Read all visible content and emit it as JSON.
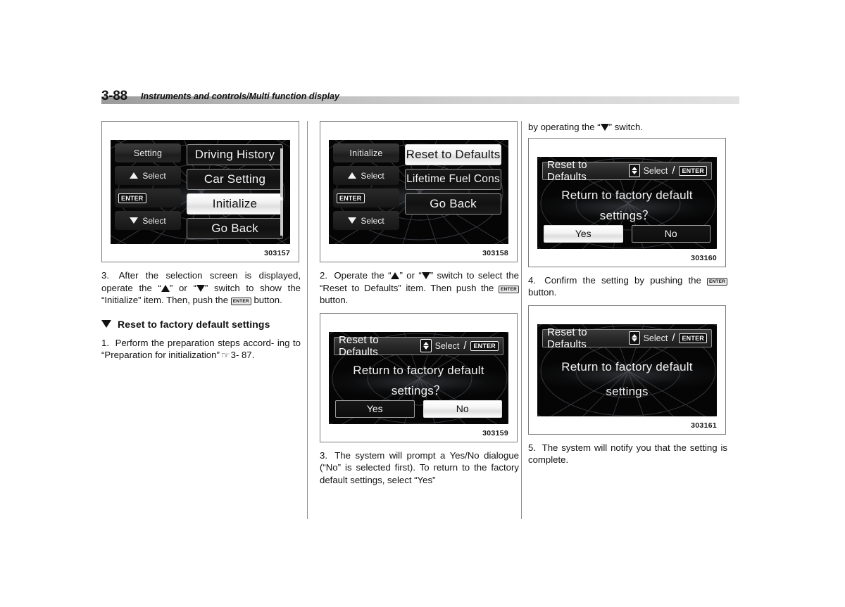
{
  "header": {
    "page_number": "3-88",
    "title": "Instruments and controls/Multi function display"
  },
  "column1": {
    "figure": {
      "figure_number": "303157",
      "screen": {
        "rail_title": "Setting",
        "rail_up_label": "Select",
        "rail_enter_label": "ENTER",
        "rail_down_label": "Select",
        "menu_items": [
          {
            "label": "Driving History",
            "selected": false
          },
          {
            "label": "Car Setting",
            "selected": false
          },
          {
            "label": "Initialize",
            "selected": true
          },
          {
            "label": "Go Back",
            "selected": false
          }
        ]
      }
    },
    "step3_a": "3.",
    "step3_b": "After the selection screen is displayed,",
    "step3_c": "operate the “",
    "step3_d": "” or “",
    "step3_e": "” switch to show the",
    "step3_f": "“Initialize” item. Then, push the",
    "step3_enter": "ENTER",
    "step3_g": "button.",
    "subheading": "Reset to factory default settings",
    "step1_num": "1.",
    "step1_a": "Perform the preparation steps accord-",
    "step1_b": "ing to “Preparation for initialization”",
    "step1_ref": "☞",
    "step1_c": "3-",
    "step1_d": "87."
  },
  "column2": {
    "figure_top": {
      "figure_number": "303158",
      "screen": {
        "rail_title": "Initialize",
        "rail_up_label": "Select",
        "rail_enter_label": "ENTER",
        "rail_down_label": "Select",
        "menu_items": [
          {
            "label": "Reset to Defaults",
            "selected": true
          },
          {
            "label": "Lifetime Fuel Cons",
            "selected": false
          },
          {
            "label": "Go Back",
            "selected": false
          }
        ]
      }
    },
    "step2_num": "2.",
    "step2_a": "Operate the “",
    "step2_b": "” or “",
    "step2_c": "” switch to",
    "step2_d": "select the “Reset to Defaults” item. Then",
    "step2_e": "push the",
    "step2_enter": "ENTER",
    "step2_f": "button.",
    "figure_bottom": {
      "figure_number": "303159",
      "screen": {
        "head_title": "Reset to Defaults",
        "head_select": "Select",
        "head_slash": "/",
        "head_enter": "ENTER",
        "message_line1": "Return to factory default",
        "message_line2": "settings？",
        "button_yes": "Yes",
        "button_no": "No",
        "selected_button": "No"
      }
    },
    "step3_num": "3.",
    "step3_a": "The system will prompt a Yes/No",
    "step3_b": "dialogue (“No” is selected first). To return",
    "step3_c": "to the factory default settings, select “Yes”"
  },
  "column3": {
    "lead_a": "by operating the “",
    "lead_b": "” switch.",
    "figure_top": {
      "figure_number": "303160",
      "screen": {
        "head_title": "Reset to Defaults",
        "head_select": "Select",
        "head_slash": "/",
        "head_enter": "ENTER",
        "message_line1": "Return to factory default",
        "message_line2": "settings？",
        "button_yes": "Yes",
        "button_no": "No",
        "selected_button": "Yes"
      }
    },
    "step4_num": "4.",
    "step4_a": "Confirm the setting by pushing the",
    "step4_enter": "ENTER",
    "step4_b": "button.",
    "figure_bottom": {
      "figure_number": "303161",
      "screen": {
        "head_title": "Reset to Defaults",
        "head_select": "Select",
        "head_slash": "/",
        "head_enter": "ENTER",
        "message_line1": "Return to factory default",
        "message_line2": "settings"
      }
    },
    "step5_num": "5.",
    "step5_a": "The system will notify you that the",
    "step5_b": "setting is complete."
  }
}
